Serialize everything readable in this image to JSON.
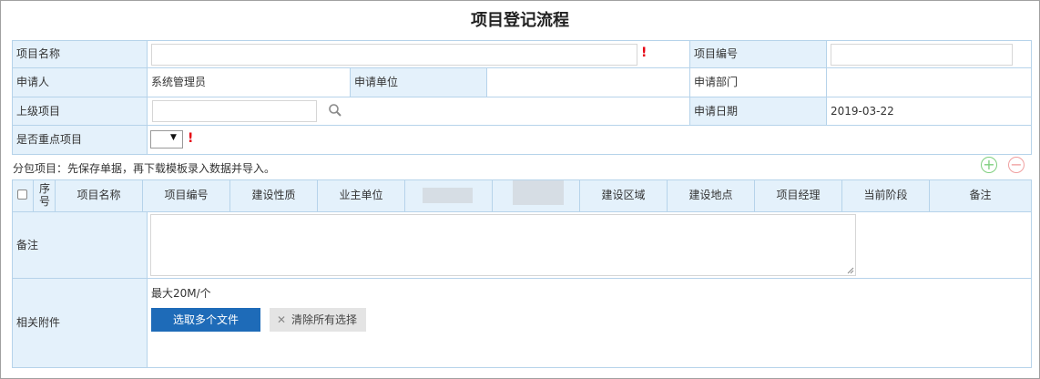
{
  "title": "项目登记流程",
  "form": {
    "project_name_label": "项目名称",
    "project_no_label": "项目编号",
    "applicant_label": "申请人",
    "applicant_value": "系统管理员",
    "apply_unit_label": "申请单位",
    "apply_dept_label": "申请部门",
    "parent_project_label": "上级项目",
    "apply_date_label": "申请日期",
    "apply_date_value": "2019-03-22",
    "key_project_label": "是否重点项目",
    "required_mark": "!",
    "select_arrow": "▼"
  },
  "subpackage": {
    "note": "分包项目：先保存单据，再下载模板录入数据并导入。",
    "add_icon": "+",
    "remove_icon": "−",
    "columns": [
      "序号",
      "项目名称",
      "项目编号",
      "建设性质",
      "业主单位",
      "",
      "",
      "建设区域",
      "建设地点",
      "项目经理",
      "当前阶段",
      "备注"
    ]
  },
  "remarks_label": "备注",
  "attachments": {
    "label": "相关附件",
    "limit": "最大20M/个",
    "select_button": "选取多个文件",
    "clear_button": "清除所有选择",
    "clear_icon": "✕"
  }
}
